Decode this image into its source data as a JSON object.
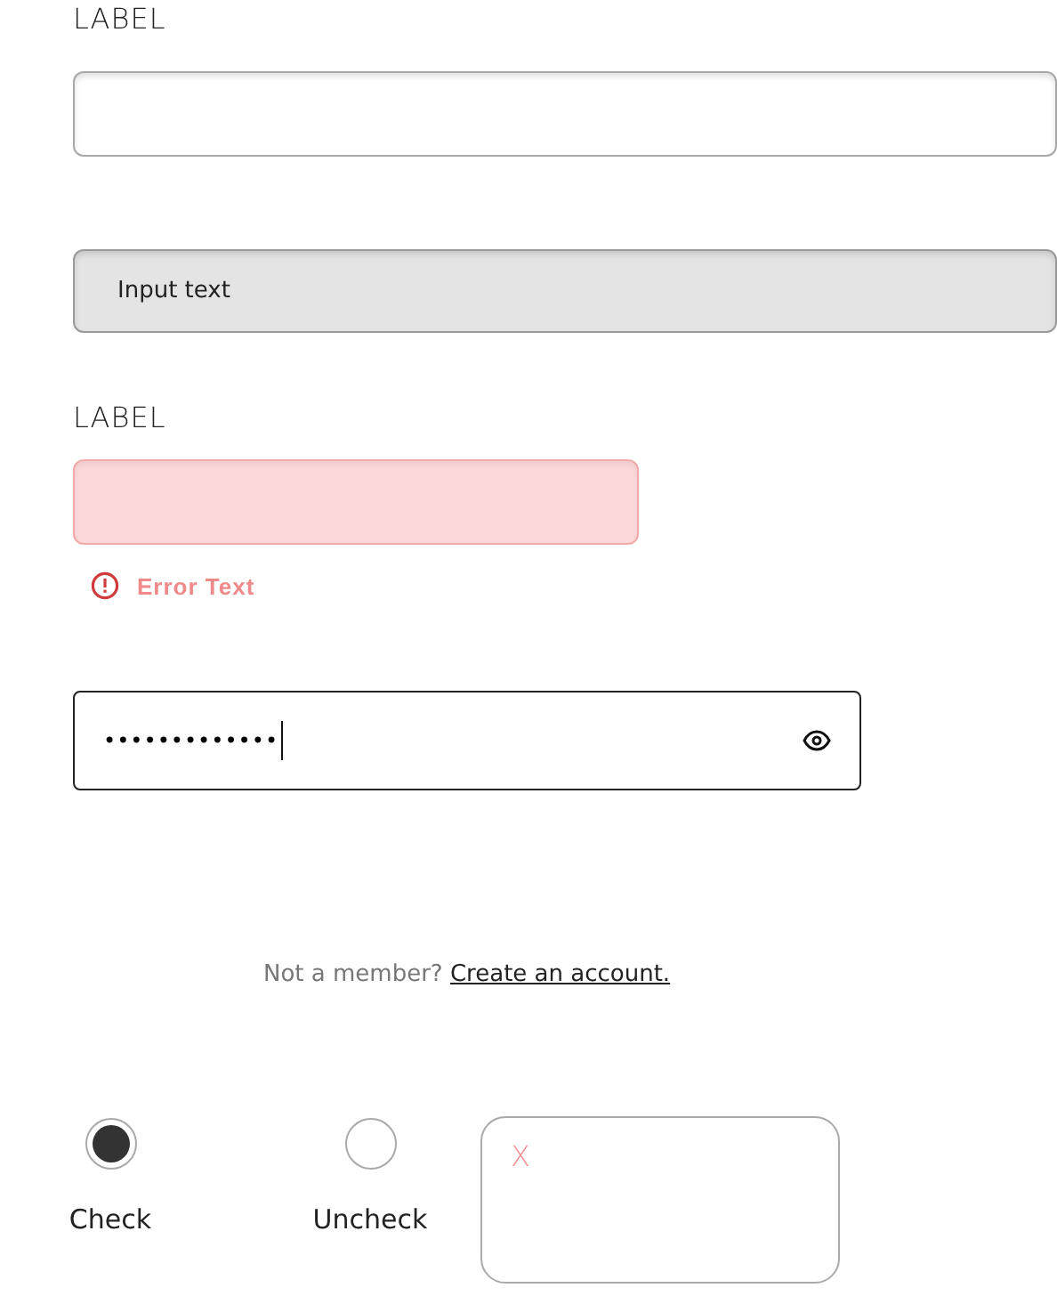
{
  "fields": [
    {
      "kind": "text",
      "label": "LABEL"
    },
    {
      "kind": "filled",
      "value": "Input text"
    },
    {
      "kind": "error",
      "label": "LABEL",
      "error": "Error Text"
    },
    {
      "kind": "password",
      "value": "•••••••••••••"
    }
  ],
  "signup": {
    "prompt": "Not a member?",
    "link": "Create an account."
  },
  "radios": [
    {
      "label": "Check",
      "selected": true
    },
    {
      "label": "Uncheck",
      "selected": false
    }
  ],
  "card": {
    "close": "X"
  }
}
